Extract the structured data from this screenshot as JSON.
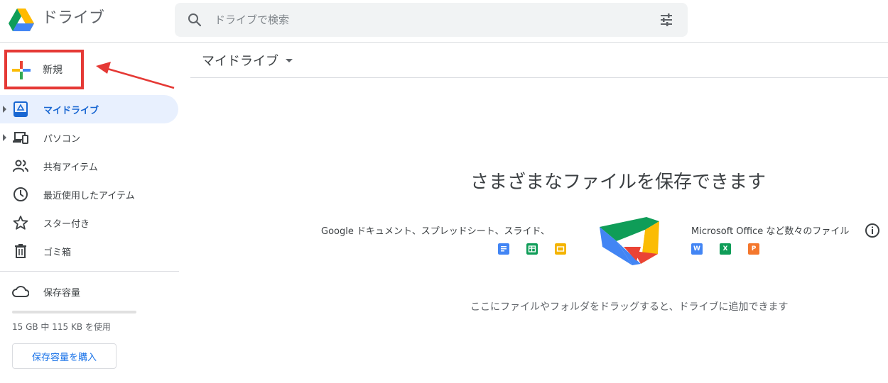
{
  "header": {
    "app_title": "ドライブ",
    "search_placeholder": "ドライブで検索"
  },
  "new_button": {
    "label": "新規"
  },
  "sidebar": {
    "items": [
      {
        "label": "マイドライブ",
        "icon": "drive-icon",
        "active": true
      },
      {
        "label": "パソコン",
        "icon": "computers-icon"
      },
      {
        "label": "共有アイテム",
        "icon": "shared-people-icon"
      },
      {
        "label": "最近使用したアイテム",
        "icon": "clock-icon"
      },
      {
        "label": "スター付き",
        "icon": "star-icon"
      },
      {
        "label": "ゴミ箱",
        "icon": "trash-icon"
      }
    ],
    "storage_label": "保存容量",
    "storage_usage_text": "15 GB 中 115 KB を使用",
    "storage_fraction_used": 0.0,
    "buy_storage_label": "保存容量を購入"
  },
  "main": {
    "title": "マイドライブ",
    "empty_heading": "さまざまなファイルを保存できます",
    "left_description": "Google ドキュメント、スプレッドシート、スライド、",
    "right_description": "Microsoft Office など数々のファイル",
    "google_apps": [
      "docs-icon",
      "sheets-icon",
      "slides-icon"
    ],
    "office_apps": [
      {
        "icon": "word-icon",
        "letter": "W",
        "color": "#4285f4"
      },
      {
        "icon": "excel-icon",
        "letter": "X",
        "color": "#0f9d58"
      },
      {
        "icon": "powerpoint-icon",
        "letter": "P",
        "color": "#f4772d"
      }
    ],
    "drop_hint": "ここにファイルやフォルダをドラッグすると、ドライブに追加できます"
  },
  "colors": {
    "accent_blue": "#1a73e8",
    "active_bg": "#e8f0fe",
    "highlight_red": "#e53935"
  }
}
